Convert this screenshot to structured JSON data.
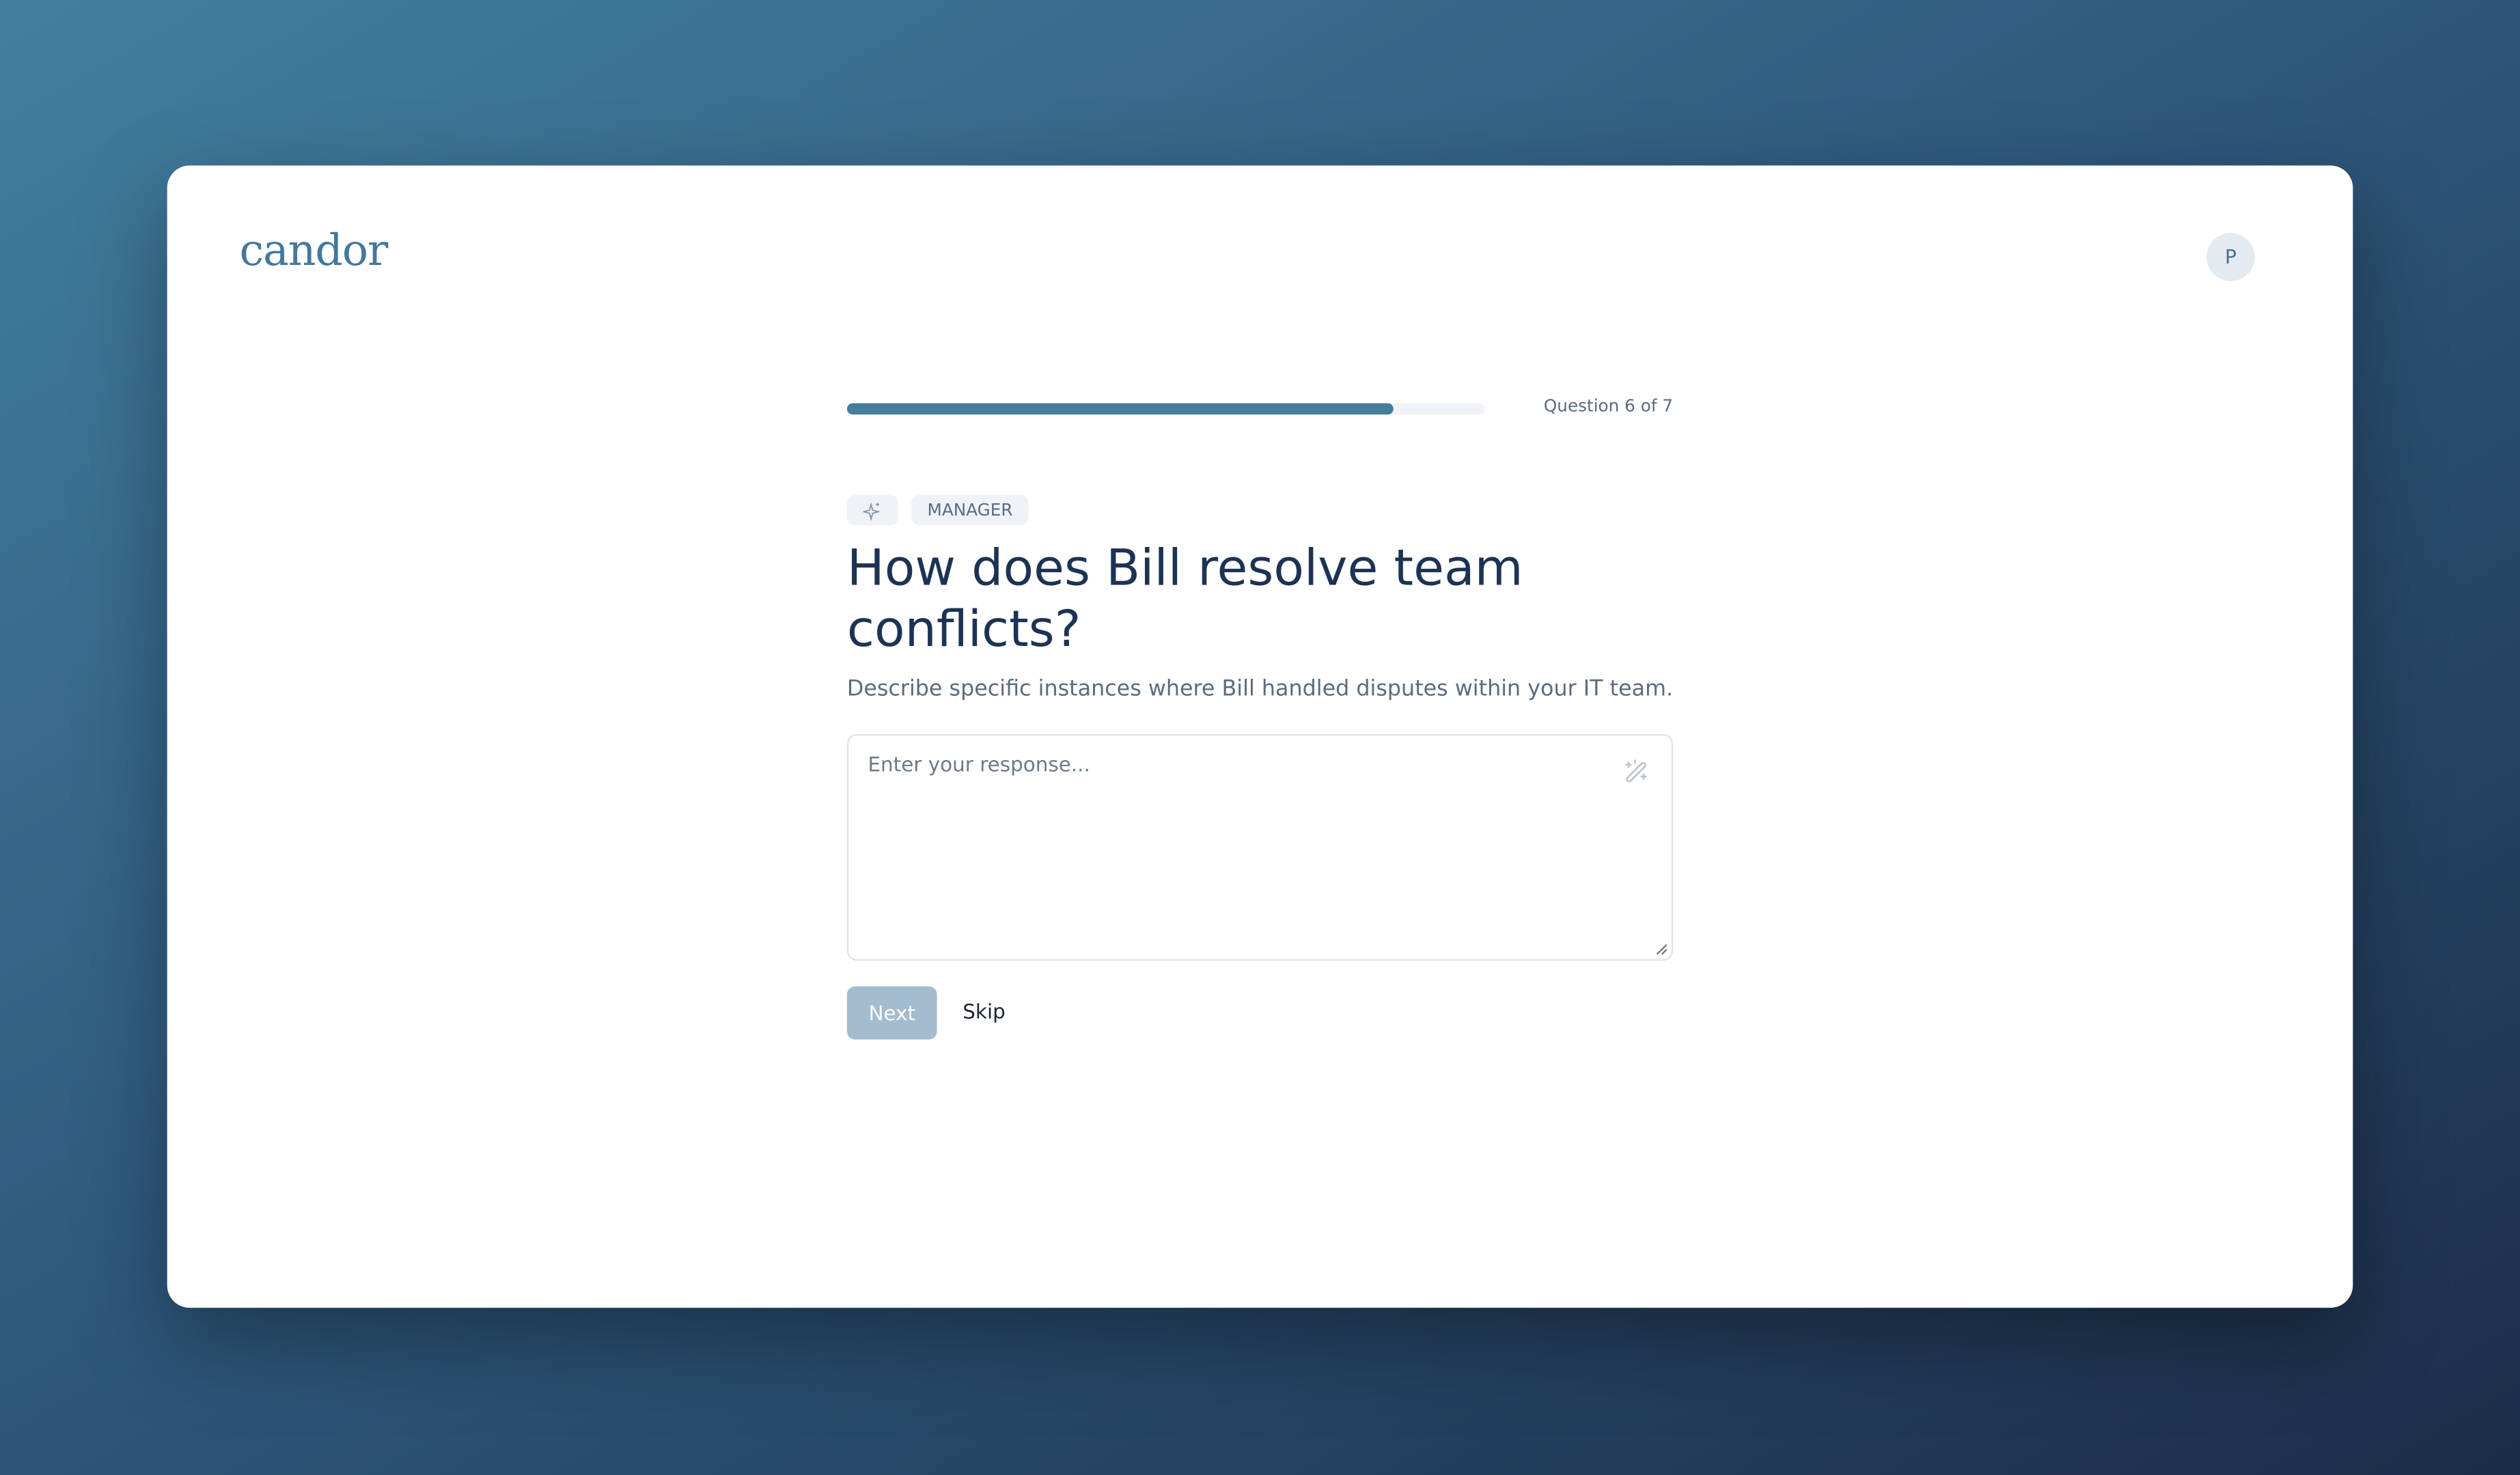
{
  "app": {
    "logo": "candor",
    "avatar_initial": "P"
  },
  "progress": {
    "current": 6,
    "total": 7,
    "fraction": 0.857,
    "label": "Question 6 of 7",
    "fill_color": "#467c9c"
  },
  "tags": {
    "icon": "sparkles-icon",
    "role": "MANAGER"
  },
  "question": {
    "title": "How does Bill resolve team conflicts?",
    "description": "Describe specific instances where Bill handled disputes within your IT team."
  },
  "response": {
    "value": "",
    "placeholder": "Enter your response...",
    "assist_icon": "magic-wand-icon"
  },
  "actions": {
    "next": "Next",
    "skip": "Skip",
    "next_color": "#a3bccf"
  }
}
